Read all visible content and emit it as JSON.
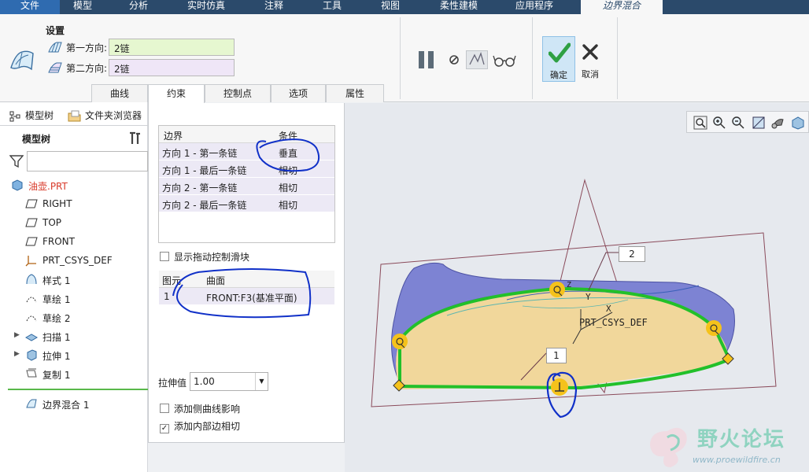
{
  "ribbon_tabs": [
    "文件",
    "模型",
    "分析",
    "实时仿真",
    "注释",
    "工具",
    "视图",
    "柔性建模",
    "应用程序",
    "边界混合"
  ],
  "settings": {
    "title": "设置",
    "dir1_label": "第一方向:",
    "dir1_value": "2链",
    "dir2_label": "第二方向:",
    "dir2_value": "2链"
  },
  "actions": {
    "ok_label": "确定",
    "cancel_label": "取消"
  },
  "sub_tabs": [
    "曲线",
    "约束",
    "控制点",
    "选项",
    "属性"
  ],
  "left_panel": {
    "tab_model_tree": "模型树",
    "tab_folder_browser": "文件夹浏览器",
    "tree_heading": "模型树",
    "items": [
      {
        "label": "油壶.PRT",
        "icon": "part-icon"
      },
      {
        "label": "RIGHT",
        "icon": "datum-plane-icon"
      },
      {
        "label": "TOP",
        "icon": "datum-plane-icon"
      },
      {
        "label": "FRONT",
        "icon": "datum-plane-icon"
      },
      {
        "label": "PRT_CSYS_DEF",
        "icon": "csys-icon"
      },
      {
        "label": "样式 1",
        "icon": "style-icon"
      },
      {
        "label": "草绘 1",
        "icon": "sketch-icon"
      },
      {
        "label": "草绘 2",
        "icon": "sketch-icon"
      },
      {
        "label": "扫描 1",
        "icon": "sweep-icon"
      },
      {
        "label": "拉伸 1",
        "icon": "extrude-icon"
      },
      {
        "label": "复制 1",
        "icon": "copy-icon"
      }
    ],
    "active_feature": "边界混合 1"
  },
  "constraints": {
    "col_boundary": "边界",
    "col_condition": "条件",
    "rows": [
      {
        "boundary": "方向 1 - 第一条链",
        "condition": "垂直"
      },
      {
        "boundary": "方向 1 - 最后一条链",
        "condition": "相切"
      },
      {
        "boundary": "方向 2 - 第一条链",
        "condition": "相切"
      },
      {
        "boundary": "方向 2 - 最后一条链",
        "condition": "相切"
      }
    ],
    "show_drag_handles": "显示拖动控制滑块",
    "col_element": "图元",
    "col_surface": "曲面",
    "surface_rows": [
      {
        "element": "1",
        "surface": "FRONT:F3(基准平面)"
      }
    ],
    "stretch_label": "拉伸值",
    "stretch_value": "1.00",
    "add_side_curve": "添加侧曲线影响",
    "add_inner_tangent": "添加内部边相切",
    "add_side_curve_checked": false,
    "add_inner_tangent_checked": true
  },
  "viewport": {
    "csys_label": "PRT_CSYS_DEF",
    "axis_x": "X",
    "axis_y": "Y",
    "axis_z": "Z",
    "callout_1": "1",
    "callout_2": "2"
  },
  "watermark": {
    "title": "野火论坛",
    "url": "www.proewildfire.cn"
  },
  "colors": {
    "ribbon_bar": "#2b4a6b",
    "ok_green": "#2ea043",
    "boundary_green": "#22c02a",
    "surface_fill": "#f1d79b",
    "annotation_ink": "#1030c8"
  }
}
